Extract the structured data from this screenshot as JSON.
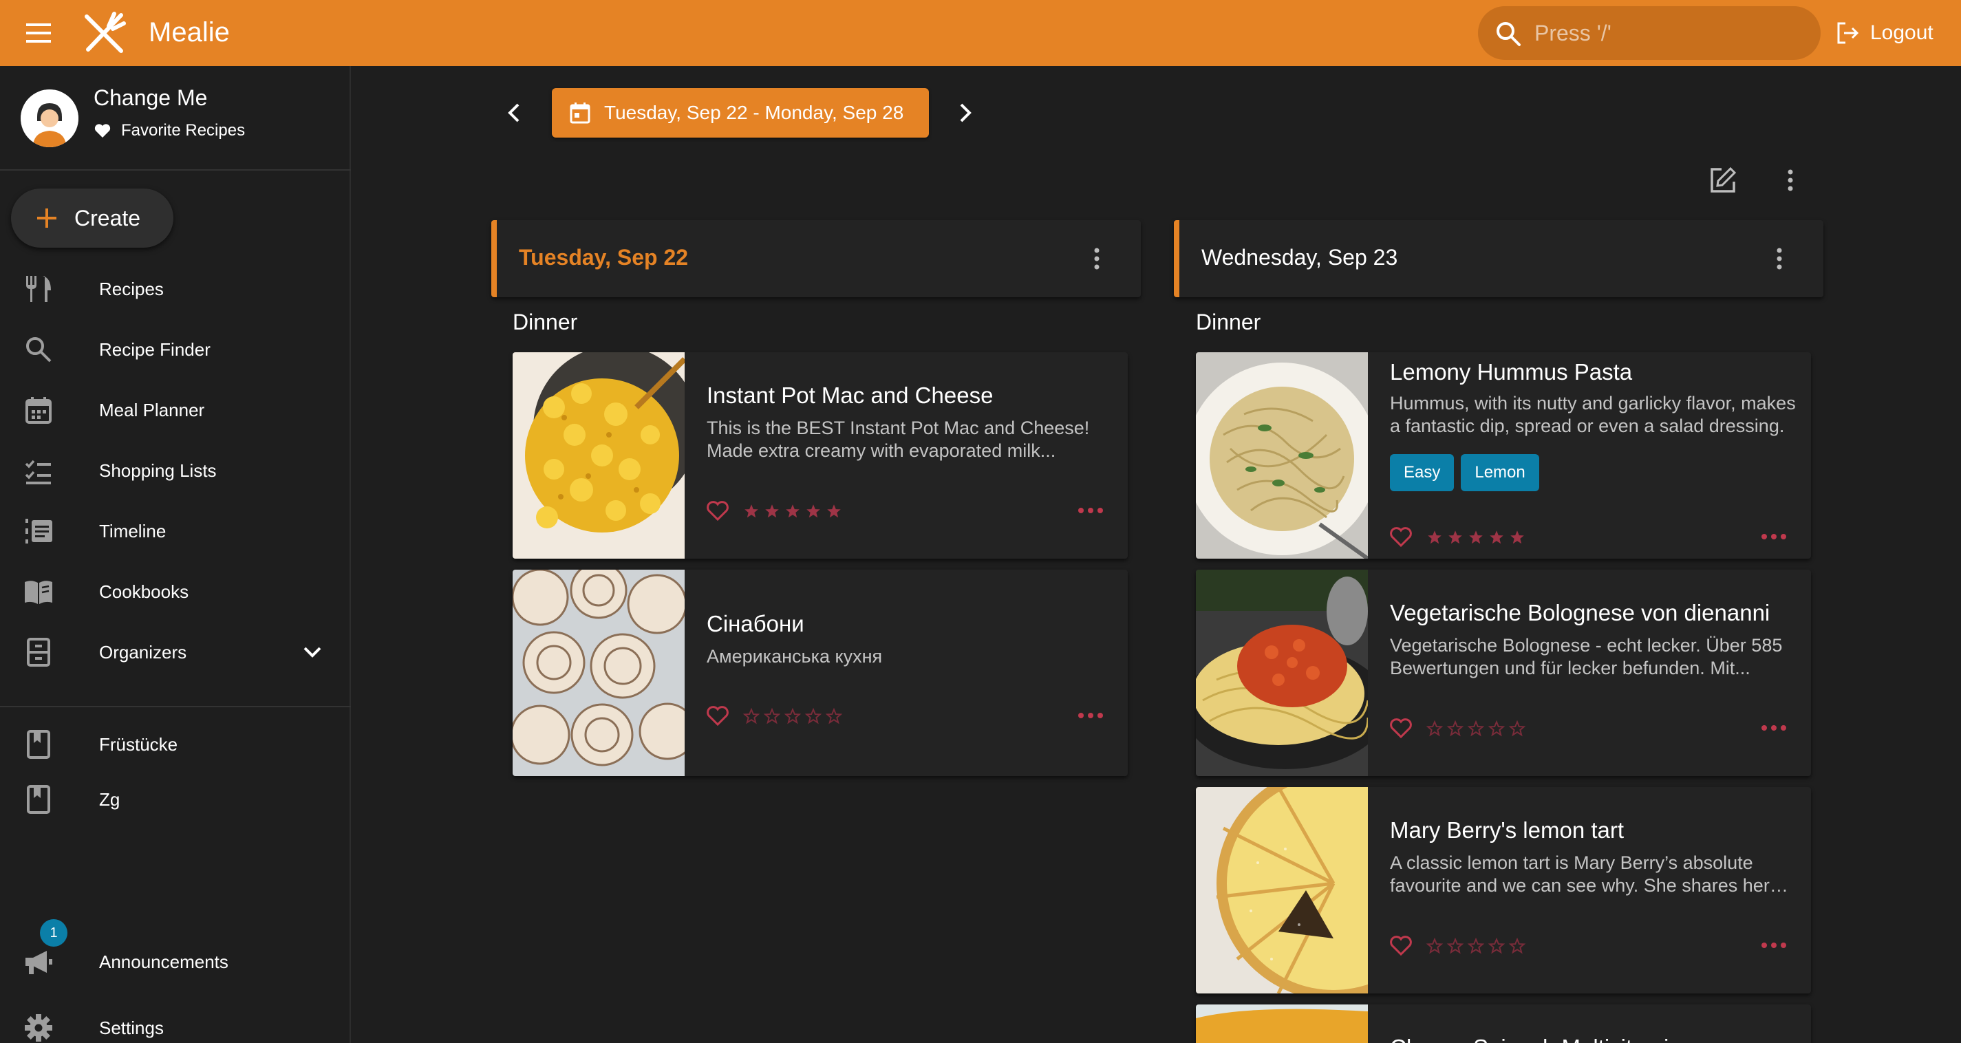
{
  "header": {
    "app_name": "Mealie",
    "search_placeholder": "Press '/'",
    "logout_label": "Logout"
  },
  "sidebar": {
    "user_name": "Change Me",
    "favorites_label": "Favorite Recipes",
    "create_label": "Create",
    "nav": [
      {
        "label": "Recipes",
        "icon": "fork-knife-icon"
      },
      {
        "label": "Recipe Finder",
        "icon": "search-icon"
      },
      {
        "label": "Meal Planner",
        "icon": "calendar-icon"
      },
      {
        "label": "Shopping Lists",
        "icon": "checklist-icon"
      },
      {
        "label": "Timeline",
        "icon": "timeline-icon"
      },
      {
        "label": "Cookbooks",
        "icon": "book-icon"
      },
      {
        "label": "Organizers",
        "icon": "cabinet-icon"
      }
    ],
    "cookbooks": [
      {
        "label": "Früstücke",
        "icon": "bookmark-book-icon"
      },
      {
        "label": "Zg",
        "icon": "bookmark-book-icon"
      }
    ],
    "announcements_label": "Announcements",
    "announcements_count": "1",
    "settings_label": "Settings"
  },
  "planner": {
    "date_range": "Tuesday, Sep 22 - Monday, Sep 28",
    "days": [
      {
        "title": "Tuesday, Sep 22",
        "meal_type": "Dinner",
        "recipes": [
          {
            "title": "Instant Pot Mac and Cheese",
            "description": "This is the BEST Instant Pot Mac and Cheese! Made extra creamy with evaporated milk...",
            "tags": [],
            "rating": 5
          },
          {
            "title": "Сінабони",
            "description": "Американська кухня",
            "tags": [],
            "rating": 0
          }
        ]
      },
      {
        "title": "Wednesday, Sep 23",
        "meal_type": "Dinner",
        "recipes": [
          {
            "title": "Lemony Hummus Pasta",
            "description": "Hummus, with its nutty and garlicky flavor, makes a fantastic dip, spread or even a salad dressing.",
            "tags": [
              "Easy",
              "Lemon"
            ],
            "rating": 5
          },
          {
            "title": "Vegetarische Bolognese von dienanni",
            "description": "Vegetarische Bolognese - echt lecker. Über 585 Bewertungen und für lecker befunden. Mit...",
            "tags": [],
            "rating": 0
          },
          {
            "title": "Mary Berry's lemon tart",
            "description": "A classic lemon tart is Mary Berry’s absolute favourite and we can see why. She shares her recipe...",
            "tags": [],
            "rating": 0
          },
          {
            "title": "Cheesy Spinach Multivitamin",
            "description": "",
            "tags": [],
            "rating": 0
          }
        ]
      }
    ]
  },
  "colors": {
    "primary": "#e58325",
    "tag": "#0b7fa8",
    "accent_red": "#c0394d",
    "background": "#1e1e1e",
    "card": "#232323"
  }
}
